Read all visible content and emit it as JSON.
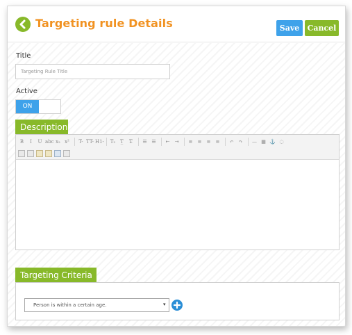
{
  "header": {
    "title": "Targeting rule Details",
    "save_label": "Save",
    "cancel_label": "Cancel"
  },
  "form": {
    "title_label": "Title",
    "title_placeholder": "Targeting Rule Title",
    "title_value": "",
    "active_label": "Active",
    "active_toggle_label": "ON",
    "active_state": true
  },
  "description": {
    "section_label": "Description",
    "toolbar_row1": [
      "B",
      "I",
      "U",
      "abc",
      "x₂",
      "x²",
      "T-",
      "TT-",
      "H1-",
      "T₂",
      "T̲",
      "T̶",
      "☰",
      "☰",
      "⇤",
      "⇥",
      "≡",
      "≡",
      "≡",
      "≡",
      "↶",
      "↷",
      "—",
      "▦",
      "⚓",
      "◌"
    ],
    "toolbar_row2_icons": [
      "cut-icon",
      "copy-icon",
      "paste-icon",
      "paste-text-icon",
      "print-icon",
      "source-icon"
    ],
    "content": ""
  },
  "criteria": {
    "section_label": "Targeting Criteria",
    "selected_option": "Person is within a certain age."
  },
  "colors": {
    "accent_green": "#88b92a",
    "title_orange": "#f19221",
    "save_blue": "#3ea2ea",
    "add_blue": "#2a8ed6"
  }
}
